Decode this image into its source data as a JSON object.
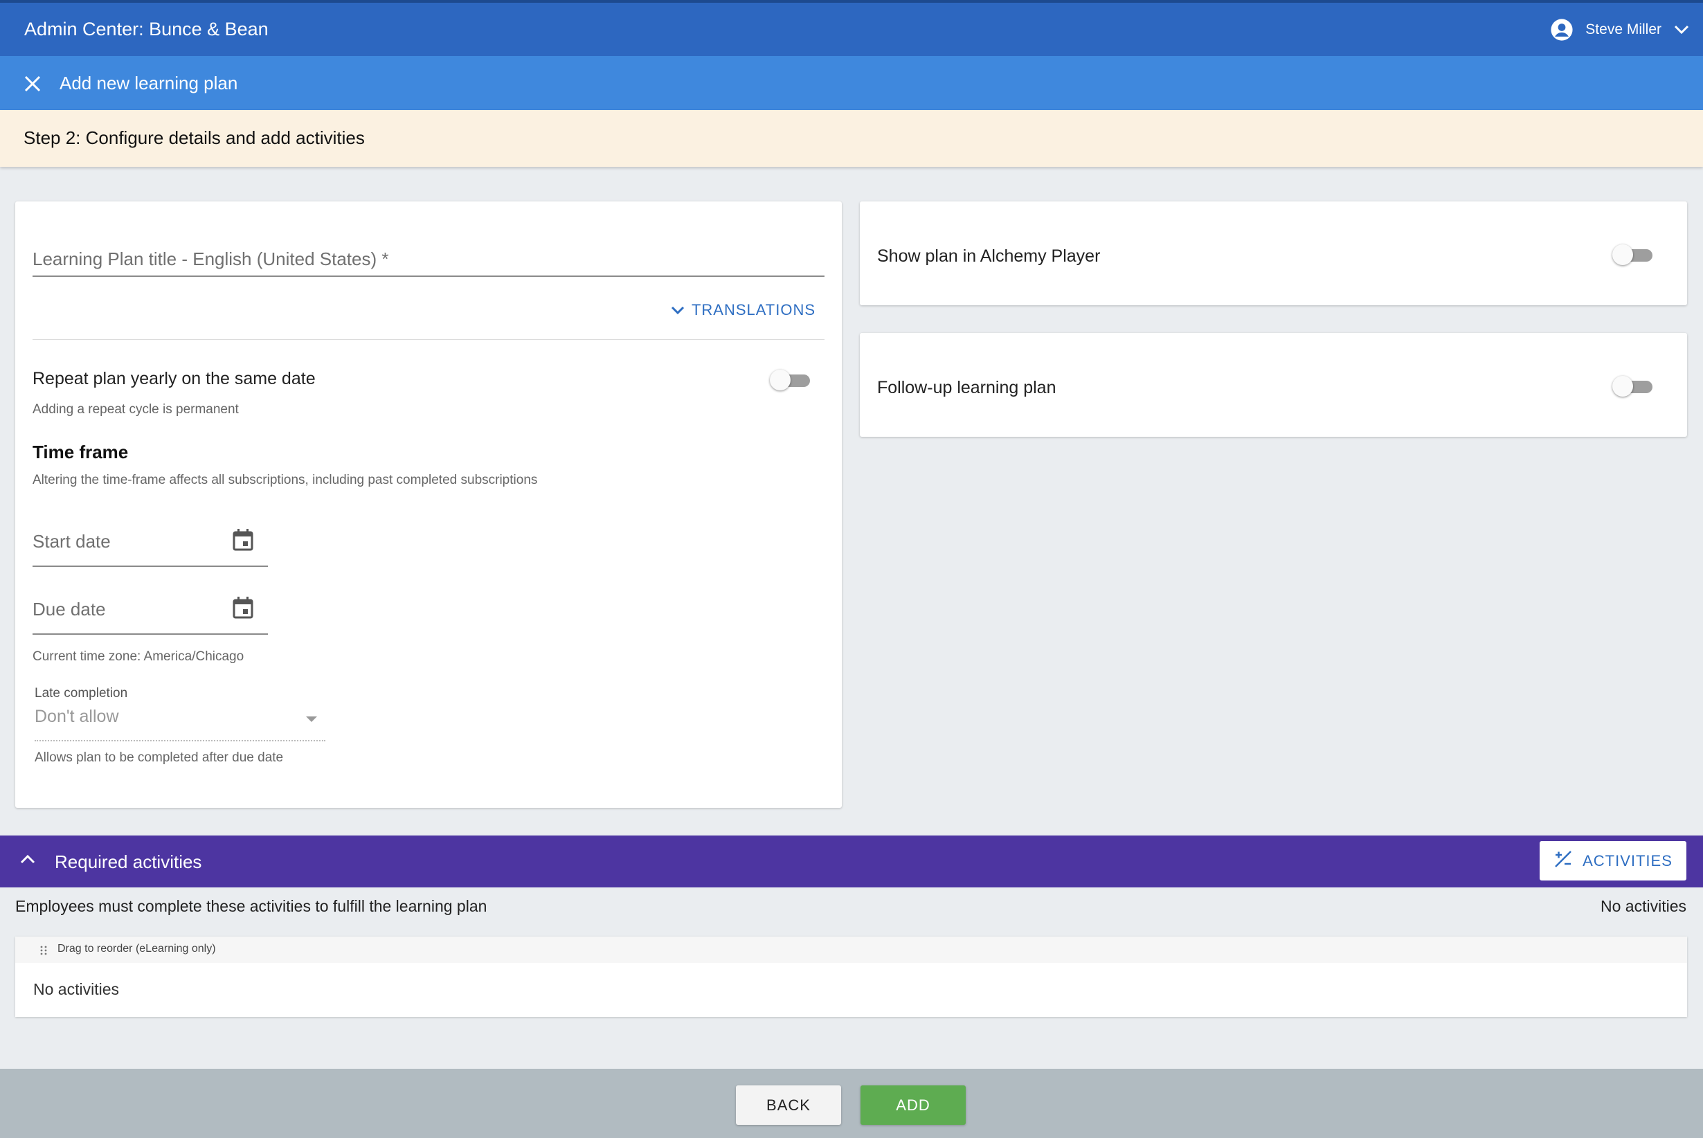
{
  "header": {
    "app_title": "Admin Center: Bunce & Bean",
    "user_name": "Steve Miller"
  },
  "subheader": {
    "title": "Add new learning plan"
  },
  "step": {
    "title": "Step 2: Configure details and add activities"
  },
  "details": {
    "title_field_placeholder": "Learning Plan title - English (United States) *",
    "translations_label": "TRANSLATIONS",
    "repeat_label": "Repeat plan yearly on the same date",
    "repeat_enabled": false,
    "repeat_hint": "Adding a repeat cycle is permanent",
    "time_frame_heading": "Time frame",
    "time_frame_hint": "Altering the time-frame affects all subscriptions, including past completed subscriptions",
    "start_date_label": "Start date",
    "due_date_label": "Due date",
    "timezone_text": "Current time zone: America/Chicago",
    "late_completion_label": "Late completion",
    "late_completion_value": "Don't allow",
    "late_completion_hint": "Allows plan to be completed after due date"
  },
  "options": {
    "show_plan_label": "Show plan in Alchemy Player",
    "show_plan_enabled": false,
    "follow_up_label": "Follow-up learning plan",
    "follow_up_enabled": false
  },
  "required_activities": {
    "title": "Required activities",
    "activities_button": "ACTIVITIES",
    "description": "Employees must complete these activities to fulfill the learning plan",
    "count_text": "No activities",
    "drag_hint": "Drag to reorder (eLearning only)",
    "empty_text": "No activities"
  },
  "footer": {
    "back_label": "BACK",
    "add_label": "ADD"
  },
  "colors": {
    "topbar": "#2d67c0",
    "subbar": "#3f88dd",
    "stepbar": "#fbf1e1",
    "required_bar": "#4d35a1",
    "link": "#2e6ec2",
    "add_button": "#5eac51",
    "footer": "#b1bbc1"
  },
  "icons": [
    "account-circle-icon",
    "chevron-down-icon",
    "close-icon",
    "calendar-icon",
    "chevron-up-icon",
    "add-activity-icon",
    "drag-handle-icon"
  ]
}
